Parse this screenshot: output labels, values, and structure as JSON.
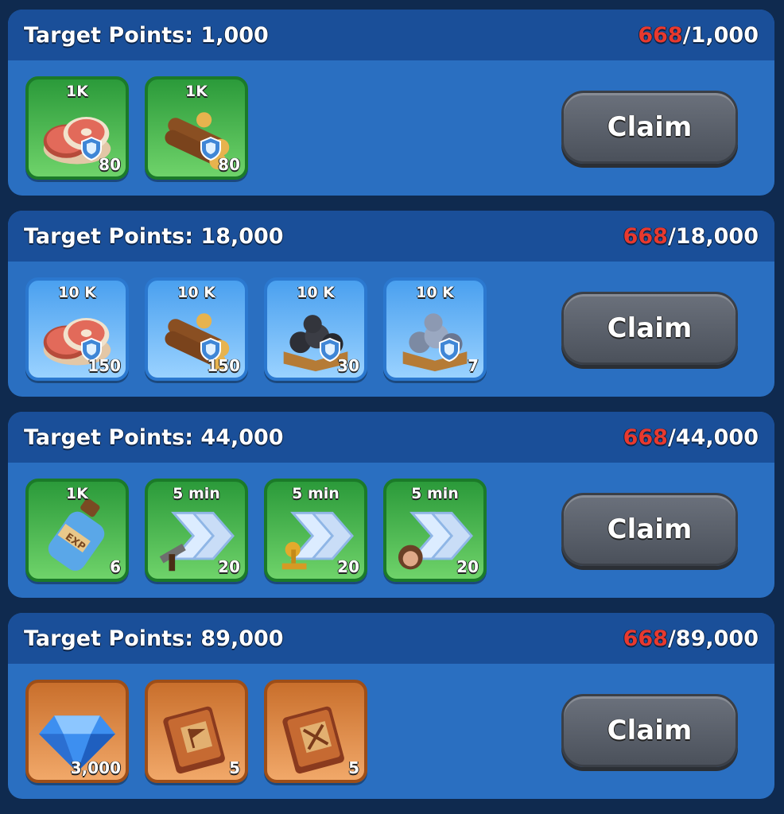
{
  "tiers": [
    {
      "title": "Target Points: 1,000",
      "current": "668",
      "target": "/1,000",
      "claim_label": "Claim",
      "rewards": [
        {
          "icon": "meat-icon",
          "top": "1K",
          "qty": "80",
          "style": "green"
        },
        {
          "icon": "wood-icon",
          "top": "1K",
          "qty": "80",
          "style": "green"
        }
      ]
    },
    {
      "title": "Target Points: 18,000",
      "current": "668",
      "target": "/18,000",
      "claim_label": "Claim",
      "rewards": [
        {
          "icon": "meat-icon",
          "top": "10 K",
          "qty": "150",
          "style": "blue"
        },
        {
          "icon": "wood-icon",
          "top": "10 K",
          "qty": "150",
          "style": "blue"
        },
        {
          "icon": "coal-icon",
          "top": "10 K",
          "qty": "30",
          "style": "blue"
        },
        {
          "icon": "iron-ore-icon",
          "top": "10 K",
          "qty": "7",
          "style": "blue"
        }
      ]
    },
    {
      "title": "Target Points: 44,000",
      "current": "668",
      "target": "/44,000",
      "claim_label": "Claim",
      "rewards": [
        {
          "icon": "exp-potion-icon",
          "top": "1K",
          "qty": "6",
          "style": "green"
        },
        {
          "icon": "speedup-build-icon",
          "top": "5 min",
          "qty": "20",
          "style": "green"
        },
        {
          "icon": "speedup-research-icon",
          "top": "5 min",
          "qty": "20",
          "style": "green"
        },
        {
          "icon": "speedup-training-icon",
          "top": "5 min",
          "qty": "20",
          "style": "green"
        }
      ]
    },
    {
      "title": "Target Points: 89,000",
      "current": "668",
      "target": "/89,000",
      "claim_label": "Claim",
      "rewards": [
        {
          "icon": "gem-icon",
          "top": "",
          "qty": "3,000",
          "style": "orange"
        },
        {
          "icon": "book-flag-icon",
          "top": "",
          "qty": "5",
          "style": "orange"
        },
        {
          "icon": "book-swords-icon",
          "top": "",
          "qty": "5",
          "style": "orange"
        }
      ]
    }
  ],
  "colors": {
    "panel": "#2a6fc1",
    "header": "#1a4f99",
    "current_points": "#e8392e",
    "claim_button": "#5d636d"
  }
}
